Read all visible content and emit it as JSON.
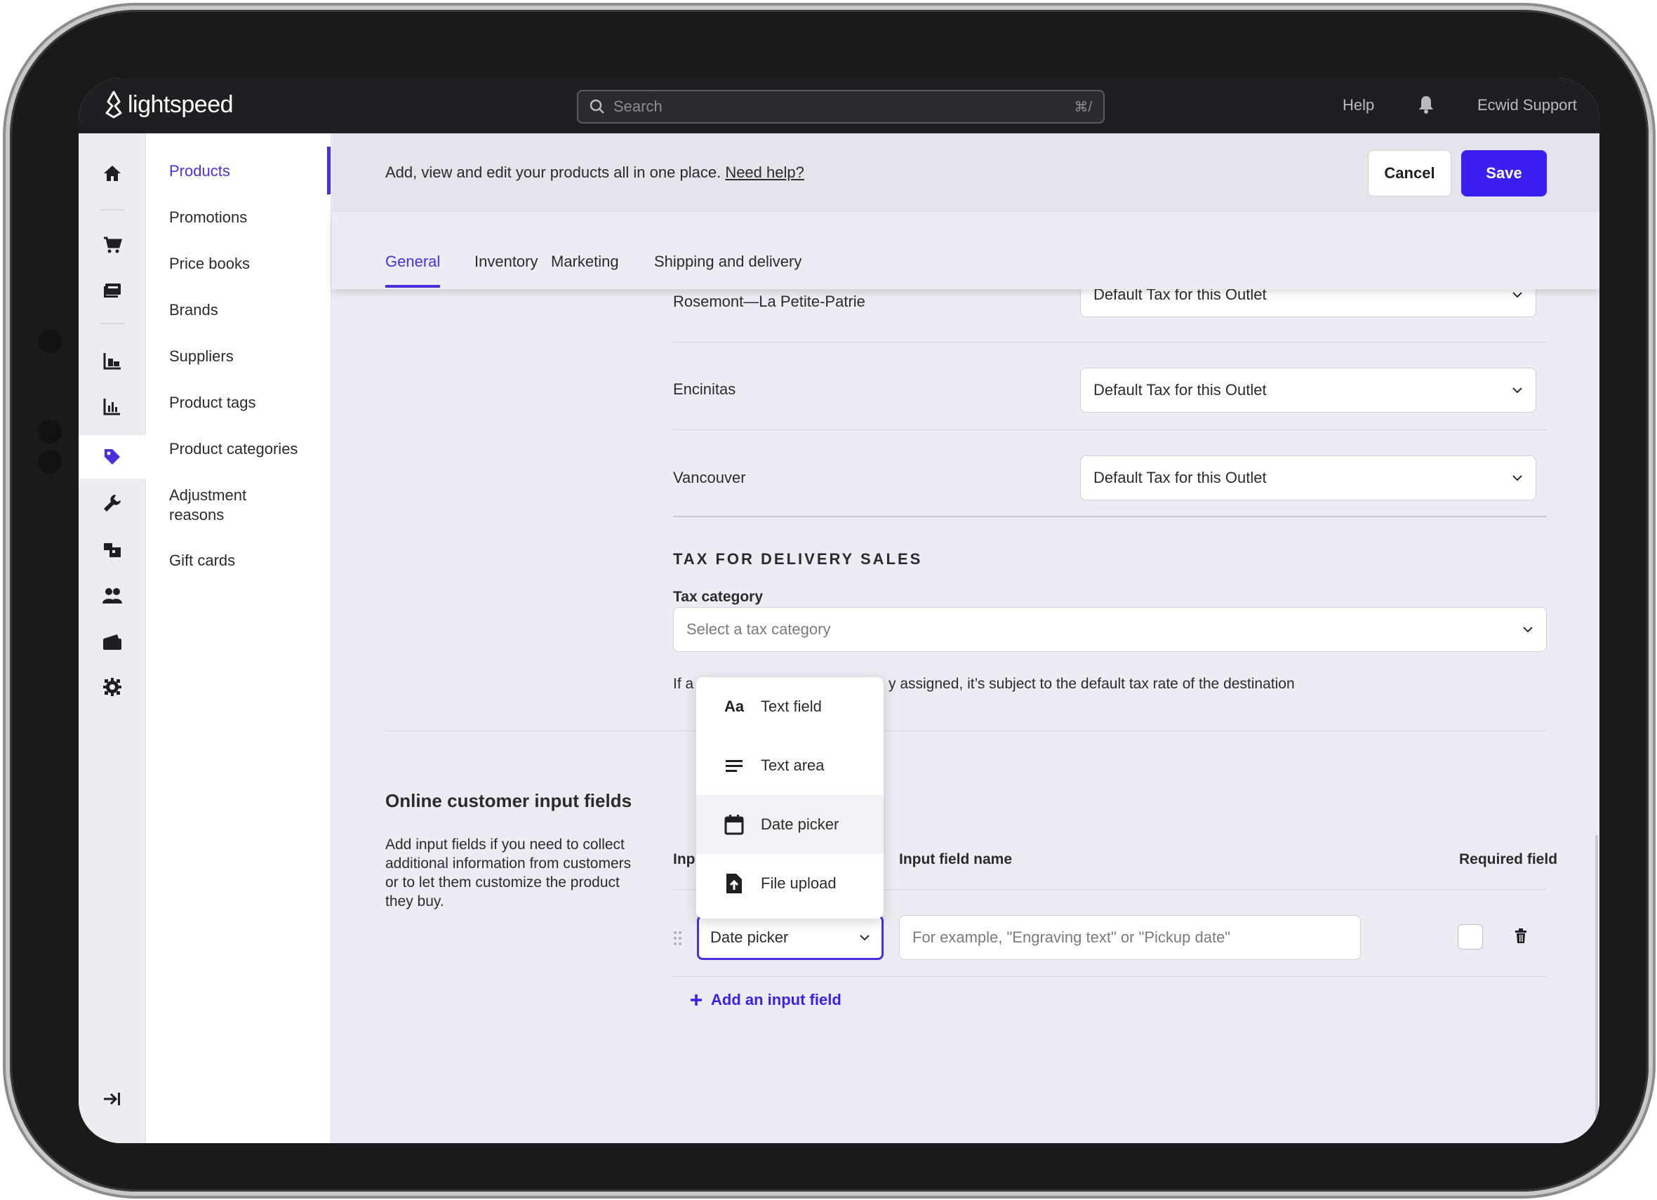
{
  "topbar": {
    "logo": "lightspeed",
    "search_placeholder": "Search",
    "search_shortcut": "⌘/",
    "help": "Help",
    "user": "Ecwid Support"
  },
  "rail_icons": [
    "home-icon",
    "cart-icon",
    "register-icon",
    "inventory-icon",
    "reports-icon",
    "tag-icon",
    "wrench-icon",
    "stores-icon",
    "customers-icon",
    "wallet-icon",
    "settings-icon",
    "collapse-icon"
  ],
  "subnav": {
    "items": [
      "Products",
      "Promotions",
      "Price books",
      "Brands",
      "Suppliers",
      "Product tags",
      "Product categories",
      "Adjustment reasons",
      "Gift cards"
    ],
    "active": "Products"
  },
  "header": {
    "description": "Add, view and edit your products all in one place.",
    "help_link": "Need help?",
    "cancel": "Cancel",
    "save": "Save"
  },
  "tabs": [
    "General",
    "Inventory",
    "Marketing",
    "Shipping and delivery"
  ],
  "outlets": [
    {
      "name": "Rosemont—La Petite-Patrie",
      "tax": "Default Tax for this Outlet"
    },
    {
      "name": "Encinitas",
      "tax": "Default Tax for this Outlet"
    },
    {
      "name": "Vancouver",
      "tax": "Default Tax for this Outlet"
    }
  ],
  "delivery": {
    "section_title": "TAX FOR DELIVERY SALES",
    "tax_category_label": "Tax category",
    "tax_category_placeholder": "Select a tax category",
    "helper_prefix": "If a",
    "helper_suffix": "y assigned, it’s subject to the default tax rate of the destination"
  },
  "online_fields": {
    "title": "Online customer input fields",
    "description": "Add input fields if you need to collect additional information from customers or to let them customize the product they buy.",
    "col_type": "Inp",
    "col_name": "Input field name",
    "col_required": "Required field",
    "row_type": "Date picker",
    "row_name_placeholder": "For example, \"Engraving text\" or \"Pickup date\"",
    "add_link": "Add an input field"
  },
  "type_menu": {
    "items": [
      {
        "label": "Text field",
        "icon": "text-field-icon"
      },
      {
        "label": "Text area",
        "icon": "text-area-icon"
      },
      {
        "label": "Date picker",
        "icon": "calendar-icon"
      },
      {
        "label": "File upload",
        "icon": "file-upload-icon"
      }
    ],
    "highlighted": "Date picker",
    "text_field_glyph": "Aa"
  },
  "colors": {
    "accent": "#4a2fe0",
    "save_button": "#3a1ff0",
    "topbar": "#1f1f23"
  }
}
